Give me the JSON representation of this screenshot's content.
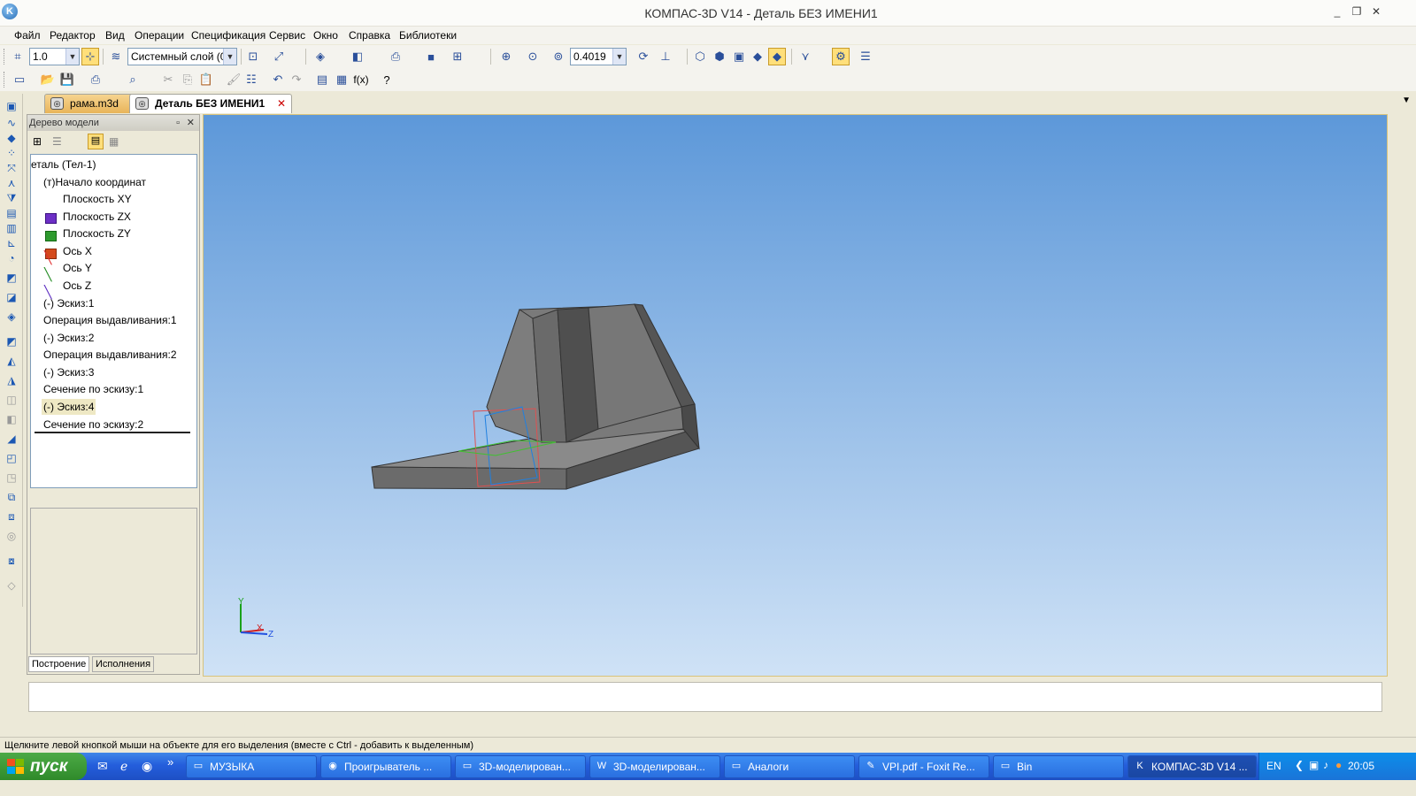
{
  "window": {
    "title": "КОМПАС-3D V14 - Деталь БЕЗ ИМЕНИ1",
    "logo": "K",
    "minimize_icon": "_",
    "restore_icon": "❐",
    "close_icon": "✕"
  },
  "menu": [
    "Файл",
    "Редактор",
    "Вид",
    "Операции",
    "Спецификация",
    "Сервис",
    "Окно",
    "Справка",
    "Библиотеки"
  ],
  "toolbar": {
    "step_value": "1.0",
    "layer_value": "Системный слой (0",
    "zoom_value": "0.4019",
    "fx_label": "f(x)"
  },
  "tabs": [
    {
      "label": "рама.m3d"
    },
    {
      "label": "Деталь БЕЗ ИМЕНИ1",
      "close": "✕"
    }
  ],
  "tabbar_menu": "▼",
  "panel": {
    "title": "Дерево модели",
    "pin": "▫",
    "close": "✕"
  },
  "tree": [
    "еталь (Тел-1)",
    "(т)Начало координат",
    "Плоскость XY",
    "Плоскость ZX",
    "Плоскость ZY",
    "Ось X",
    "Ось Y",
    "Ось Z",
    "(-) Эскиз:1",
    "Операция выдавливания:1",
    "(-) Эскиз:2",
    "Операция выдавливания:2",
    "(-) Эскиз:3",
    "Сечение по эскизу:1",
    "(-) Эскиз:4",
    "Сечение по эскизу:2"
  ],
  "panel_tabs": [
    "Построение",
    "Исполнения"
  ],
  "axes": {
    "x": "X",
    "y": "Y",
    "z": "Z"
  },
  "status_text": "Щелкните левой кнопкой мыши на объекте для его выделения (вместе с Ctrl - добавить к выделенным)",
  "taskbar": {
    "start_label": "пуск",
    "quicklaunch_more": "»",
    "items": [
      "МУЗЫКА",
      "Проигрыватель ...",
      "3D-моделирован...",
      "3D-моделирован...",
      "Аналоги",
      "VPI.pdf - Foxit Re...",
      "Bin",
      "КОМПАС-3D V14 ..."
    ],
    "lang": "EN",
    "time": "20:05"
  },
  "colors": {
    "viewport_top": "#5d98d9",
    "viewport_bottom": "#cfe2f6",
    "taskbar": "#245edc",
    "start": "#3a9a36",
    "model": "#7a7a7a"
  }
}
